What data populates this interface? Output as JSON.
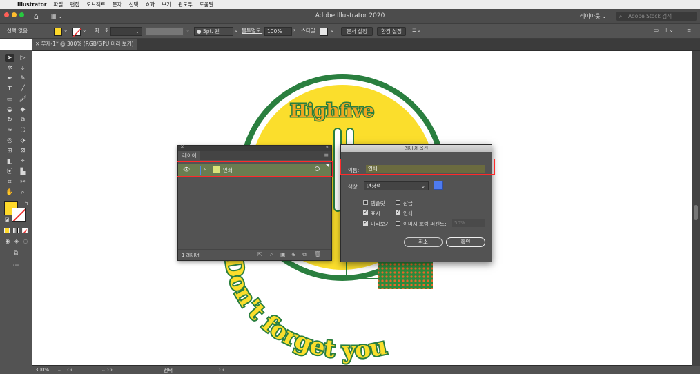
{
  "menubar": {
    "app": "Illustrator",
    "items": [
      "파일",
      "편집",
      "오브젝트",
      "문자",
      "선택",
      "효과",
      "보기",
      "윈도우",
      "도움말"
    ]
  },
  "titlebar": {
    "title": "Adobe Illustrator 2020",
    "layout_menu": "레이아웃",
    "search_placeholder": "Adobe Stock 검색"
  },
  "controlbar": {
    "selection": "선택 없음",
    "stroke_label": "획:",
    "stroke_profile": "5pt. 원",
    "opacity_label": "불투명도:",
    "opacity_value": "100%",
    "style_label": "스타일:",
    "document_setup": "문서 설정",
    "preferences": "환경 설정",
    "fill_color": "#ffd92a"
  },
  "doc_tab": {
    "label": "무제-1* @ 300% (RGB/GPU 미리 보기)"
  },
  "artwork": {
    "headline": "Highfive",
    "tagline": "Don't forget you"
  },
  "layers_panel": {
    "tab": "레이어",
    "layer_name": "인쇄",
    "count": "1 레이어"
  },
  "layer_options": {
    "title": "레이어 옵션",
    "name_label": "이름:",
    "name_value": "인쇄",
    "color_label": "색상:",
    "color_value": "연청색",
    "color_swatch": "#4e7bf0",
    "template_label": "템플릿",
    "lock_label": "잠금",
    "show_label": "표시",
    "print_label": "인쇄",
    "preview_label": "미리보기",
    "dim_label": "이미지 흐림 퍼센트:",
    "dim_value": "50%",
    "template_checked": false,
    "lock_checked": false,
    "show_checked": true,
    "print_checked": true,
    "preview_checked": true,
    "dim_checked": false,
    "cancel_label": "취소",
    "ok_label": "확인"
  },
  "statusbar": {
    "zoom": "300%",
    "artboard": "1",
    "tool": "선택"
  }
}
